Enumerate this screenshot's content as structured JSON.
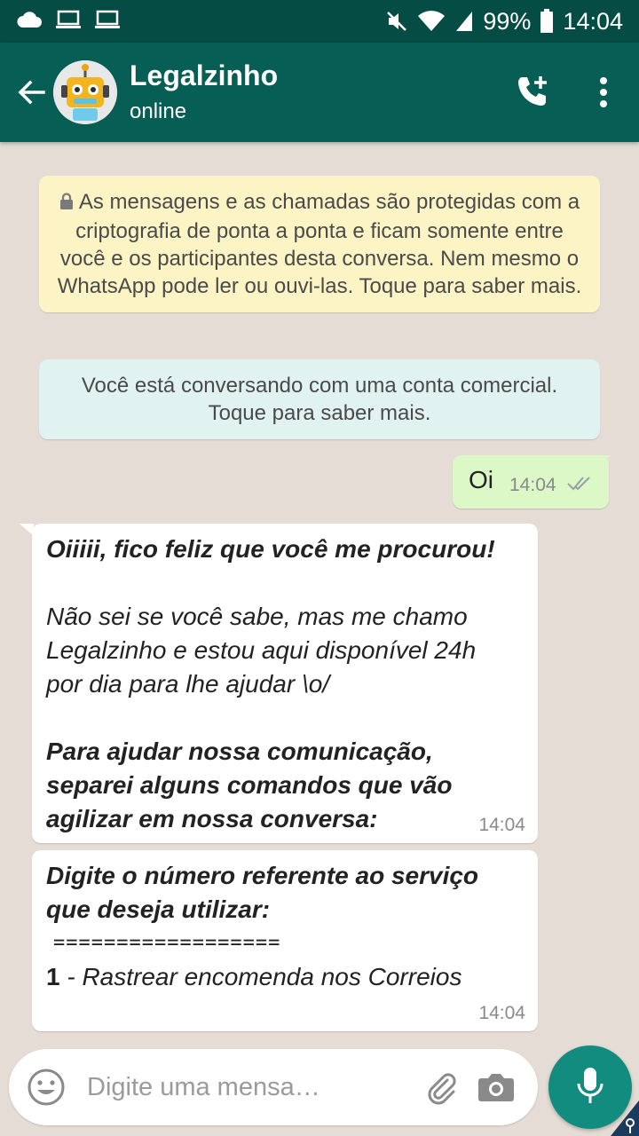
{
  "status_bar": {
    "battery": "99%",
    "time": "14:04",
    "icons": [
      "cloud-icon",
      "laptop-icon",
      "laptop-icon",
      "mute-icon",
      "wifi-icon",
      "signal-icon",
      "battery-icon"
    ]
  },
  "header": {
    "contact_name": "Legalzinho",
    "presence": "online",
    "icons": [
      "back-arrow-icon",
      "robot-avatar",
      "add-call-icon",
      "more-vert-icon"
    ]
  },
  "chat": {
    "encryption_notice": "As mensagens e as chamadas são protegidas com a criptografia de ponta a ponta e ficam somente entre você e os participantes desta conversa. Nem mesmo o WhatsApp pode ler ou ouvi-las. Toque para saber mais.",
    "business_notice_line1": "Você está conversando com uma conta comercial.",
    "business_notice_line2": "Toque para saber mais.",
    "outgoing": {
      "text": "Oi",
      "time": "14:04",
      "status": "delivered"
    },
    "incoming1": {
      "line1": "Oiiiii, fico feliz que você me procurou!",
      "para2_l1": "Não sei se você sabe, mas me chamo",
      "para2_l2": "Legalzinho e estou aqui disponível 24h",
      "para2_l3": "por dia para lhe ajudar \\o/",
      "para3_l1": "Para ajudar nossa comunicação,",
      "para3_l2": "separei alguns comandos que vão",
      "para3_l3": "agilizar em nossa conversa:",
      "time": "14:04"
    },
    "incoming2": {
      "line1": "Digite o número referente ao serviço",
      "line2": "que deseja utilizar:",
      "separator": "==================",
      "option_number": "1",
      "option_text": " - Rastrear encomenda nos Correios",
      "time": "14:04"
    }
  },
  "composer": {
    "placeholder": "Digite uma mensa…"
  },
  "colors": {
    "header": "#075e54",
    "status_bar": "#054d44",
    "chat_bg": "#e5ddd5",
    "outgoing_bubble": "#dcf8c6",
    "mic_button": "#128c7e",
    "encryption_notice_bg": "#fdf4c5",
    "business_notice_bg": "#e1f3f1"
  }
}
